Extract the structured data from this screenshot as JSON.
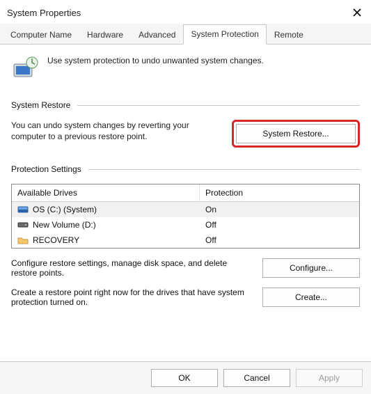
{
  "window": {
    "title": "System Properties"
  },
  "tabs": {
    "t0": "Computer Name",
    "t1": "Hardware",
    "t2": "Advanced",
    "t3": "System Protection",
    "t4": "Remote"
  },
  "intro": "Use system protection to undo unwanted system changes.",
  "restore": {
    "header": "System Restore",
    "desc": "You can undo system changes by reverting your computer to a previous restore point.",
    "button": "System Restore..."
  },
  "protection": {
    "header": "Protection Settings",
    "col_drive": "Available Drives",
    "col_prot": "Protection",
    "rows": [
      {
        "name": "OS (C:) (System)",
        "prot": "On"
      },
      {
        "name": "New Volume (D:)",
        "prot": "Off"
      },
      {
        "name": "RECOVERY",
        "prot": "Off"
      }
    ],
    "configure_desc": "Configure restore settings, manage disk space, and delete restore points.",
    "configure_btn": "Configure...",
    "create_desc": "Create a restore point right now for the drives that have system protection turned on.",
    "create_btn": "Create..."
  },
  "footer": {
    "ok": "OK",
    "cancel": "Cancel",
    "apply": "Apply"
  }
}
